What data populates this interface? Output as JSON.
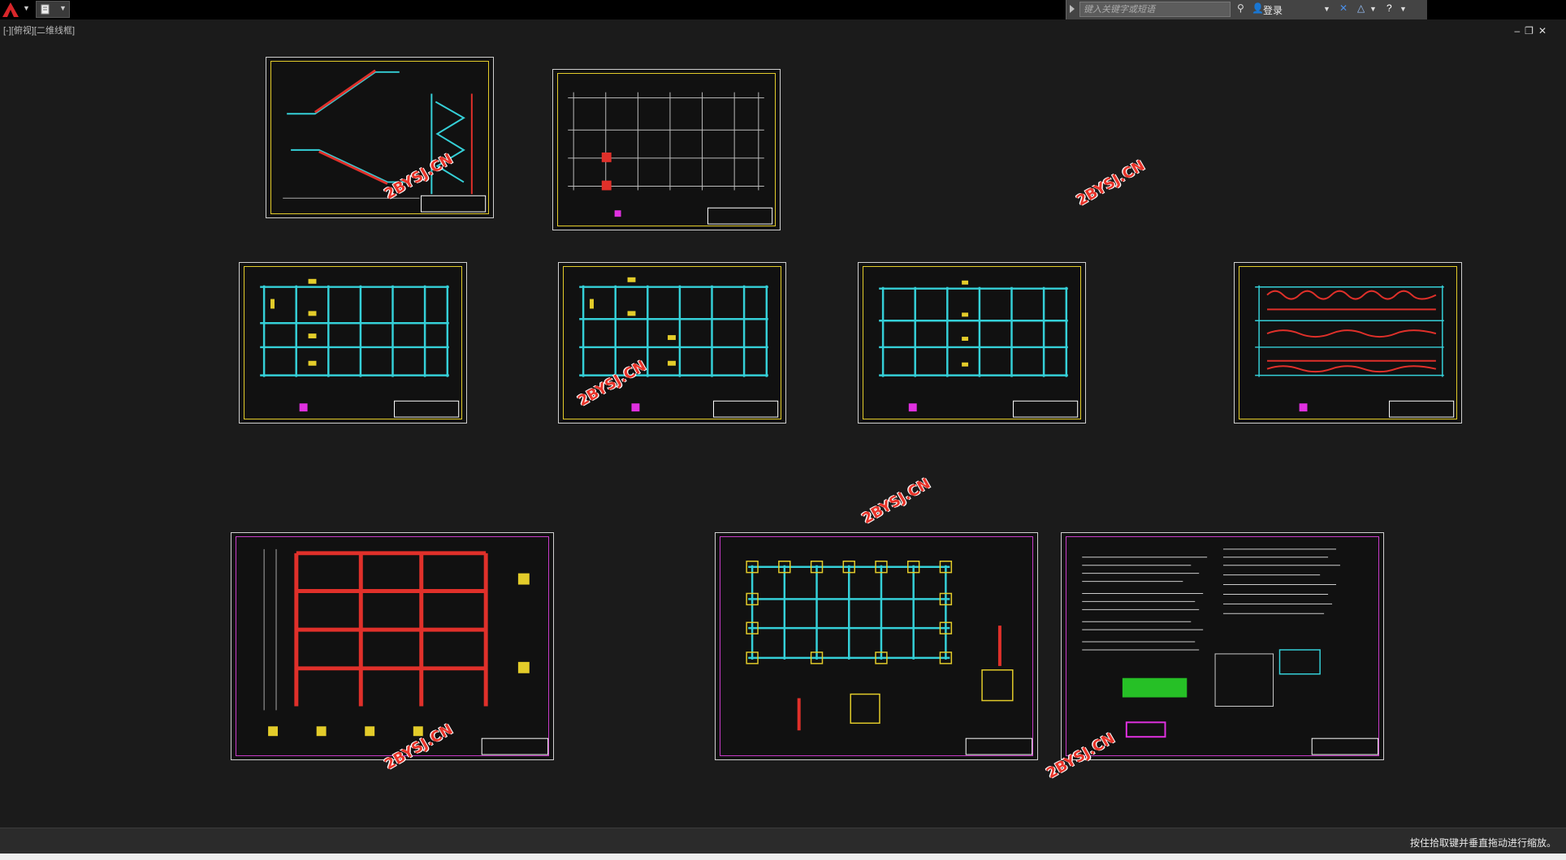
{
  "toolbar": {
    "app_icon": "autocad-a-icon",
    "qat_icon": "document-edit-icon"
  },
  "infocenter": {
    "search_placeholder": "键入关键字或短语",
    "login_label": "登录"
  },
  "viewport": {
    "label": "[-][俯视][二维线框]"
  },
  "watermark": {
    "text": "2BYSJ.CN"
  },
  "status": {
    "prompt": "按住拾取键并垂直拖动进行缩放。"
  },
  "colors": {
    "background": "#1b1b1b",
    "border_yellow": "#e3cc2a",
    "border_magenta": "#c93cc9",
    "grid_cyan": "#35d0d8",
    "rebar_red": "#e0302a",
    "watermark_red": "#e8342a"
  }
}
